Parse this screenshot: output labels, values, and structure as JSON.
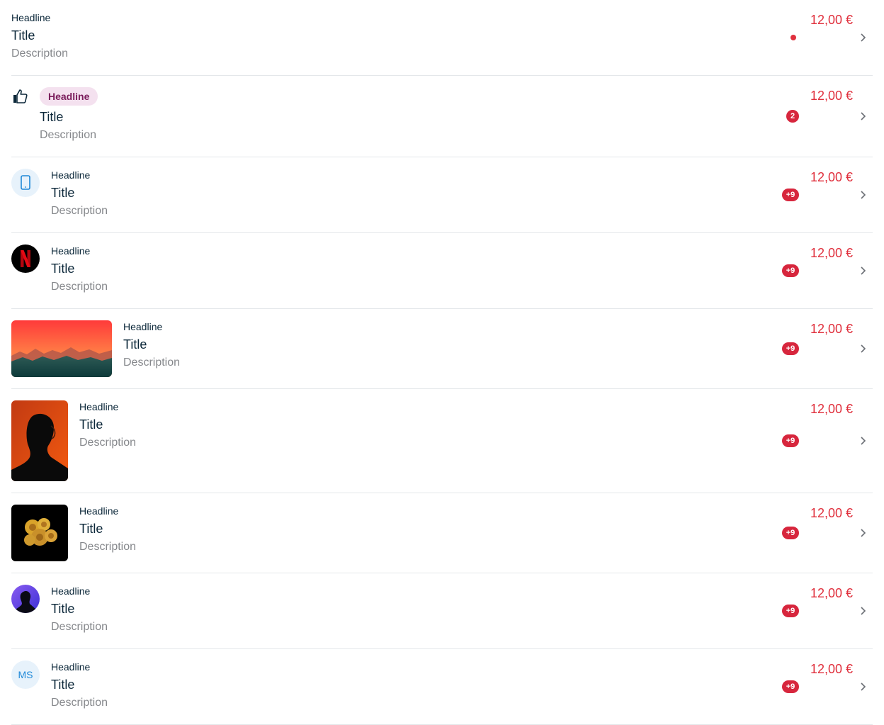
{
  "accent_colors": {
    "price": "#e0303d",
    "badge": "#d7263d",
    "tag_bg": "#f4e1ef",
    "tag_text": "#7b1d5c",
    "icon_blue": "#1e88d8"
  },
  "rows": [
    {
      "headline": "Headline",
      "title": "Title",
      "description": "Description",
      "price": "12,00 €",
      "indicator": "dot"
    },
    {
      "headline": "Headline",
      "title": "Title",
      "description": "Description",
      "price": "12,00 €",
      "badge": "2",
      "asset_icon": "thumbs-up-icon"
    },
    {
      "headline": "Headline",
      "title": "Title",
      "description": "Description",
      "price": "12,00 €",
      "badge": "+9",
      "asset_icon": "mobile-phone-icon"
    },
    {
      "headline": "Headline",
      "title": "Title",
      "description": "Description",
      "price": "12,00 €",
      "badge": "+9",
      "asset_icon": "netflix-logo-icon"
    },
    {
      "headline": "Headline",
      "title": "Title",
      "description": "Description",
      "price": "12,00 €",
      "badge": "+9",
      "asset_icon": "landscape-image"
    },
    {
      "headline": "Headline",
      "title": "Title",
      "description": "Description",
      "price": "12,00 €",
      "badge": "+9",
      "asset_icon": "portrait-image"
    },
    {
      "headline": "Headline",
      "title": "Title",
      "description": "Description",
      "price": "12,00 €",
      "badge": "+9",
      "asset_icon": "roses-image"
    },
    {
      "headline": "Headline",
      "title": "Title",
      "description": "Description",
      "price": "12,00 €",
      "badge": "+9",
      "asset_icon": "avatar-image"
    },
    {
      "headline": "Headline",
      "title": "Title",
      "description": "Description",
      "price": "12,00 €",
      "badge": "+9",
      "initials": "MS"
    }
  ]
}
